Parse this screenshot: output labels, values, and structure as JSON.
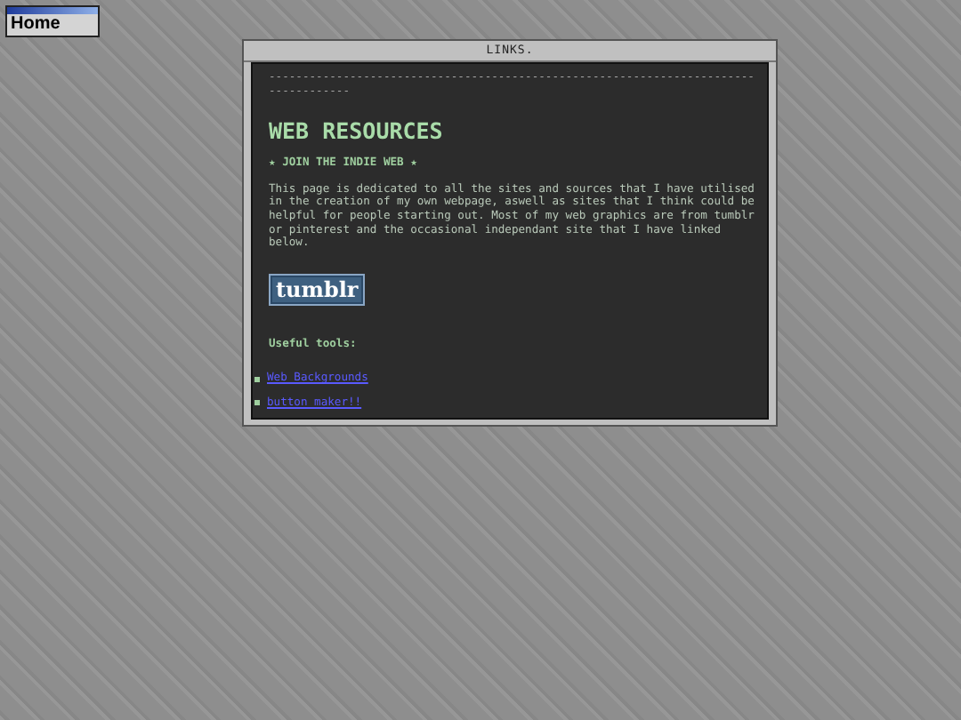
{
  "home_button": {
    "label": "Home"
  },
  "window": {
    "title": "LINKS.",
    "divider": "------------------------------------------------------------------------------------",
    "heading": "WEB RESOURCES",
    "subheading": "★ JOIN THE INDIE WEB ★",
    "intro": "This page is dedicated to all the sites and sources that I have utilised in the creation of my own webpage, aswell as sites that I think could be helpful for people starting out. Most of my web graphics are from tumblr or pinterest and the occasional independant site that I have linked below.",
    "badge": "tumblr",
    "tools_label": "Useful tools:",
    "links": [
      {
        "label": "Web Backgrounds"
      },
      {
        "label": "button maker!!"
      }
    ]
  }
}
